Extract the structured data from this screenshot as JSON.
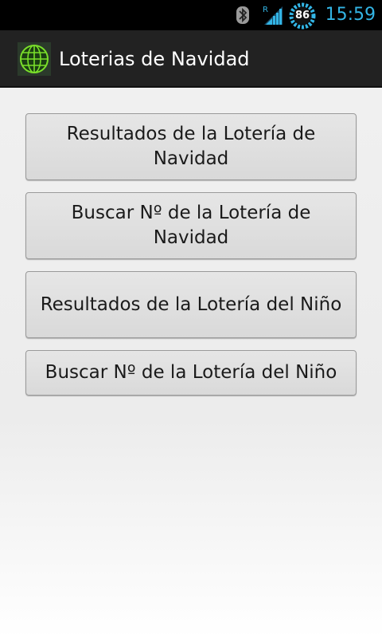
{
  "status_bar": {
    "time": "15:59",
    "battery_level": "86",
    "signal_roaming_label": "R",
    "icons": [
      "bluetooth-icon",
      "signal-icon",
      "battery-icon"
    ],
    "accent_color": "#33b5e5"
  },
  "action_bar": {
    "title": "Loterias de Navidad",
    "icon": "globe-icon",
    "background_color": "#222222"
  },
  "menu": {
    "buttons": [
      {
        "label": "Resultados de la Lotería de Navidad"
      },
      {
        "label": "Buscar Nº de la Lotería de Navidad"
      },
      {
        "label": "Resultados de la Lotería del Niño"
      },
      {
        "label": "Buscar Nº de la Lotería del Niño"
      }
    ]
  }
}
